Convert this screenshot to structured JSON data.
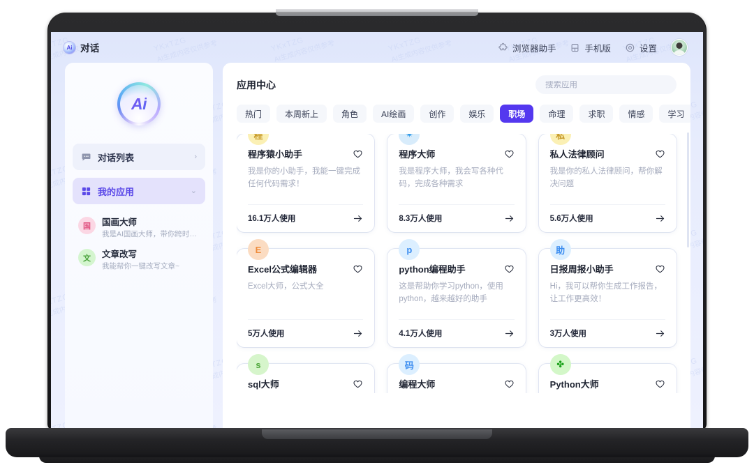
{
  "window": {
    "brand_logo_text": "Ai",
    "brand_title": "对话"
  },
  "header": {
    "items": [
      {
        "label": "浏览器助手",
        "icon": "puzzle-icon"
      },
      {
        "label": "手机版",
        "icon": "mobile-icon"
      },
      {
        "label": "设置",
        "icon": "gear-icon"
      }
    ],
    "avatar_name": "user-avatar"
  },
  "sidebar": {
    "logo_text": "Ai",
    "nav": [
      {
        "label": "对话列表",
        "icon": "chat-icon",
        "caret": "›",
        "active": false
      },
      {
        "label": "我的应用",
        "icon": "grid-icon",
        "caret": "⌄",
        "active": true
      }
    ],
    "apps": [
      {
        "initial": "国",
        "name": "国画大师",
        "desc": "我是AI国画大师，带你跨时代体...",
        "color": "pink"
      },
      {
        "initial": "文",
        "name": "文章改写",
        "desc": "我能帮你一键改写文章~",
        "color": "green"
      }
    ]
  },
  "main": {
    "title": "应用中心",
    "search": {
      "placeholder": "搜索应用",
      "value": ""
    },
    "tabs": [
      {
        "label": "热门",
        "active": false
      },
      {
        "label": "本周新上",
        "active": false
      },
      {
        "label": "角色",
        "active": false
      },
      {
        "label": "AI绘画",
        "active": false
      },
      {
        "label": "创作",
        "active": false
      },
      {
        "label": "娱乐",
        "active": false
      },
      {
        "label": "职场",
        "active": true
      },
      {
        "label": "命理",
        "active": false
      },
      {
        "label": "求职",
        "active": false
      },
      {
        "label": "情感",
        "active": false
      },
      {
        "label": "学习",
        "active": false
      }
    ],
    "cards": [
      {
        "avatar_text": "程",
        "avatar_style": "av-yellow",
        "title": "程序猿小助手",
        "desc": "我是你的小助手，我能一键完成任何代码需求！",
        "uses": "16.1万人使用"
      },
      {
        "avatar_text": "✷",
        "avatar_style": "av-blue",
        "title": "程序大师",
        "desc": "我是程序大师，我会写各种代码，完成各种需求",
        "uses": "8.3万人使用"
      },
      {
        "avatar_text": "私",
        "avatar_style": "av-yellow",
        "title": "私人法律顾问",
        "desc": "我是你的私人法律顾问，帮你解决问题",
        "uses": "5.6万人使用"
      },
      {
        "avatar_text": "E",
        "avatar_style": "av-orange",
        "title": "Excel公式编辑器",
        "desc": "Excel大师，公式大全",
        "uses": "5万人使用"
      },
      {
        "avatar_text": "p",
        "avatar_style": "av-lblue",
        "title": "python编程助手",
        "desc": "这是帮助你学习python，使用python，越来越好的助手",
        "uses": "4.1万人使用"
      },
      {
        "avatar_text": "助",
        "avatar_style": "av-lblue",
        "title": "日报周报小助手",
        "desc": "Hi，我可以帮你生成工作报告，让工作更高效！",
        "uses": "3万人使用"
      },
      {
        "avatar_text": "s",
        "avatar_style": "av-green",
        "title": "sql大师",
        "desc": "",
        "uses": ""
      },
      {
        "avatar_text": "码",
        "avatar_style": "av-lblue",
        "title": "编程大师",
        "desc": "",
        "uses": ""
      },
      {
        "avatar_text": "✤",
        "avatar_style": "av-darkgreen",
        "title": "Python大师",
        "desc": "",
        "uses": ""
      }
    ]
  },
  "watermark": {
    "line1": "YKxTZG",
    "line2": "AI生成内容仅供参考"
  },
  "colors": {
    "accent": "#5438ef",
    "sidebar_active_bg": "#e4e2fc",
    "sidebar_active_text": "#5b49e8",
    "page_bg": "#e7ecfd",
    "card_bg": "#ffffff"
  }
}
